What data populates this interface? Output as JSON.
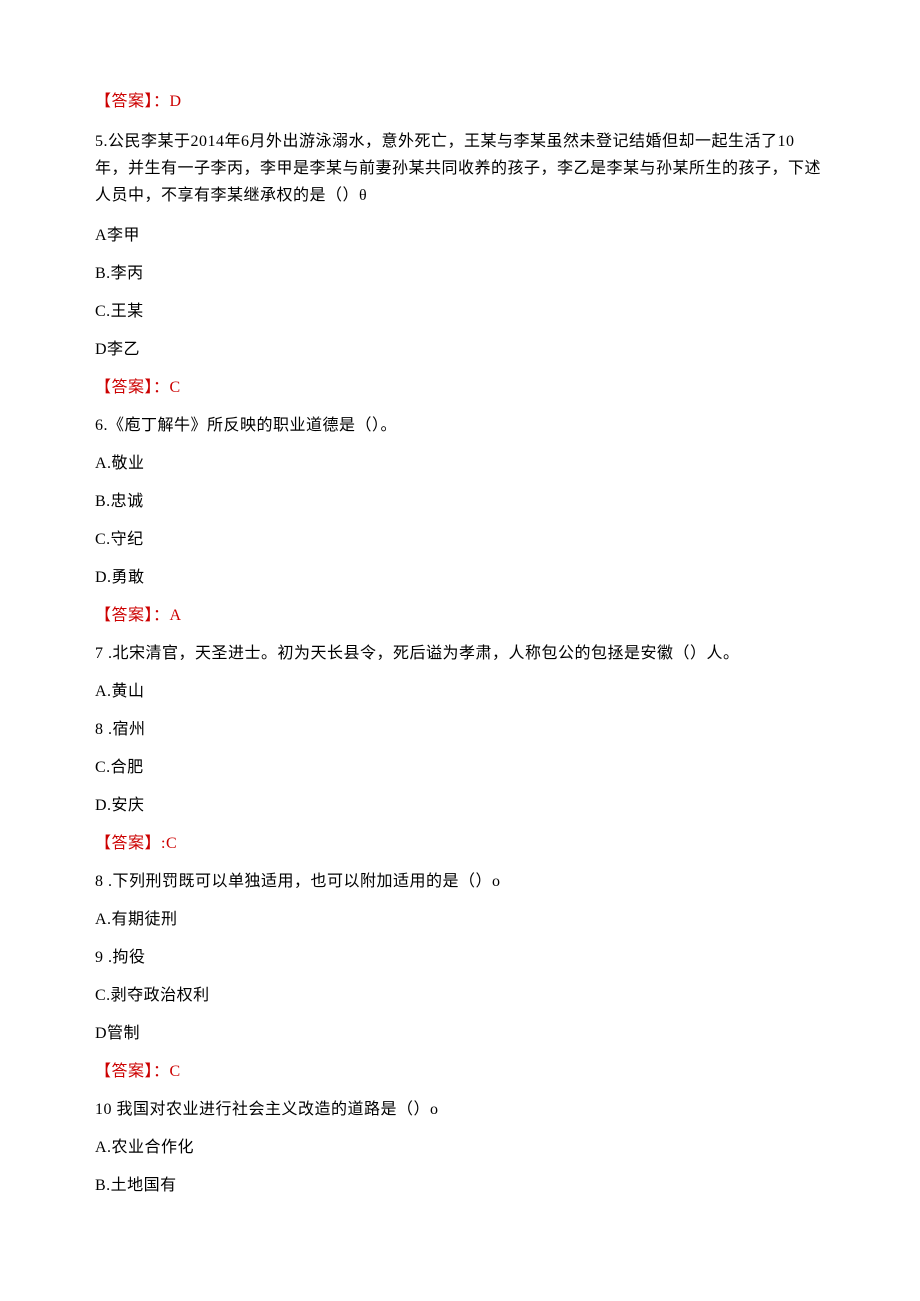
{
  "answer4": "【答案】：D",
  "question5": "5.公民李某于2014年6月外出游泳溺水，意外死亡，王某与李某虽然未登记结婚但却一起生活了10年，并生有一子李丙，李甲是李某与前妻孙某共同收养的孩子，李乙是李某与孙某所生的孩子，下述人员中，不享有李某继承权的是（）θ",
  "q5_optA": "A李甲",
  "q5_optB": "B.李丙",
  "q5_optC": "C.王某",
  "q5_optD": "D李乙",
  "answer5": "【答案】：C",
  "question6": "6.《庖丁解牛》所反映的职业道德是（）。",
  "q6_optA": "A.敬业",
  "q6_optB": "B.忠诚",
  "q6_optC": "C.守纪",
  "q6_optD": "D.勇敢",
  "answer6": "【答案】：A",
  "question7": "7 .北宋清官，天圣进士。初为天长县令，死后谥为孝肃，人称包公的包拯是安徽（）人。",
  "q7_optA": "A.黄山",
  "q7_optB": "8 .宿州",
  "q7_optC": "C.合肥",
  "q7_optD": "D.安庆",
  "answer7": "【答案】:C",
  "question8": "8 .下列刑罚既可以单独适用，也可以附加适用的是（）o",
  "q8_optA": "A.有期徒刑",
  "q8_optB": "9 .拘役",
  "q8_optC": "C.剥夺政治权利",
  "q8_optD": "D管制",
  "answer8": "【答案】：C",
  "question10": "10 我国对农业进行社会主义改造的道路是（）o",
  "q10_optA": "A.农业合作化",
  "q10_optB": "B.土地国有"
}
